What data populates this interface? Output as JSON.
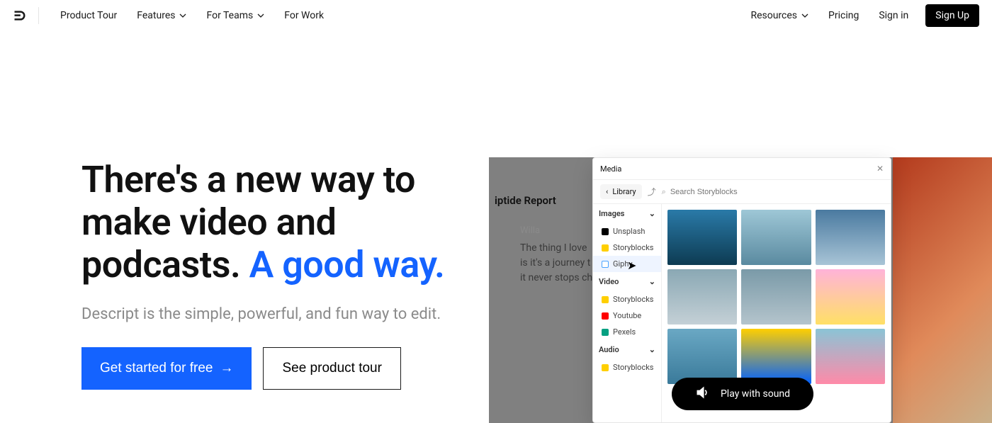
{
  "nav": {
    "items": [
      "Product Tour",
      "Features",
      "For Teams",
      "For Work"
    ],
    "right": [
      "Resources",
      "Pricing",
      "Sign in"
    ],
    "signup": "Sign Up"
  },
  "hero": {
    "headline_a": "There's a new way to make video and podcasts. ",
    "headline_b": "A good way.",
    "sub": "Descript is the simple, powerful, and fun way to edit.",
    "primary": "Get started for free",
    "primary_arrow": "→",
    "secondary": "See product tour"
  },
  "preview": {
    "doc_title": "iptide Report",
    "speaker": "Willa",
    "quote_l1": "The thing I love",
    "quote_l2": "is it's a journey t",
    "quote_l3": "it never stops ch",
    "panel_title": "Media",
    "library": "Library",
    "search_placeholder": "Search Storyblocks",
    "groups": {
      "images": {
        "label": "Images",
        "items": [
          "Unsplash",
          "Storyblocks",
          "Giphy"
        ]
      },
      "video": {
        "label": "Video",
        "items": [
          "Storyblocks",
          "Youtube",
          "Pexels"
        ]
      },
      "audio": {
        "label": "Audio",
        "items": [
          "Storyblocks"
        ]
      }
    },
    "play_sound": "Play with sound"
  }
}
